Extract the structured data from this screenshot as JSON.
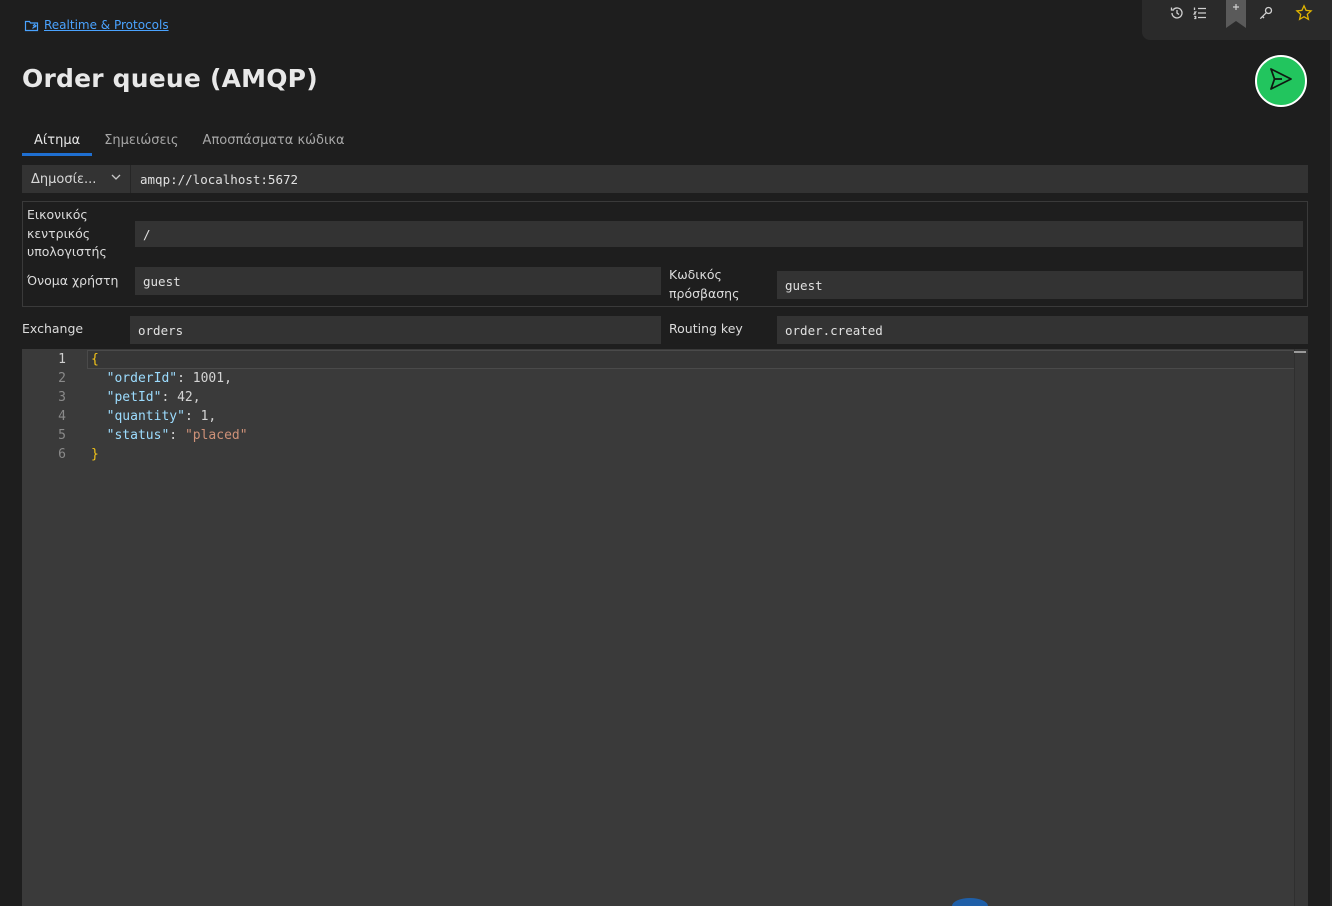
{
  "breadcrumb": {
    "label": "Realtime & Protocols",
    "icon": "folder-plug-icon"
  },
  "page": {
    "title": "Order queue (AMQP)"
  },
  "toolbar": {
    "items": [
      "history-icon",
      "list-icon",
      "bookmark-icon",
      "key-icon",
      "star-icon"
    ]
  },
  "send": {
    "icon": "send-icon",
    "color": "#22c55e"
  },
  "tabs": [
    {
      "label": "Αίτημα",
      "active": true
    },
    {
      "label": "Σημειώσεις",
      "active": false
    },
    {
      "label": "Αποσπάσματα κώδικα",
      "active": false
    }
  ],
  "request": {
    "visibility_select": "Δημοσίε...",
    "url": "amqp://localhost:5672"
  },
  "auth": {
    "vhost_label_1": "Εικονικός",
    "vhost_label_2": "κεντρικός",
    "vhost_label_3": "υπολογιστής",
    "vhost_value": "/",
    "username_label": "Όνομα χρήστη",
    "username_value": "guest",
    "password_label_1": "Κωδικός",
    "password_label_2": "πρόσβασης",
    "password_value": "guest"
  },
  "routing": {
    "exchange_label": "Exchange",
    "exchange_value": "orders",
    "routing_key_label": "Routing key",
    "routing_key_value": "order.created"
  },
  "editor": {
    "line_numbers": [
      "1",
      "2",
      "3",
      "4",
      "5",
      "6"
    ],
    "body": {
      "open": "{",
      "l2_key": "\"orderId\"",
      "l2_val": "1001",
      "l3_key": "\"petId\"",
      "l3_val": "42",
      "l4_key": "\"quantity\"",
      "l4_val": "1",
      "l5_key": "\"status\"",
      "l5_val": "\"placed\"",
      "close": "}",
      "colon": ": ",
      "comma": ","
    }
  },
  "colors": {
    "accent": "#1f6fd1",
    "link": "#4aa3ff",
    "brace": "#f5c518",
    "json_key": "#9cdcfe",
    "json_string": "#ce9178"
  }
}
